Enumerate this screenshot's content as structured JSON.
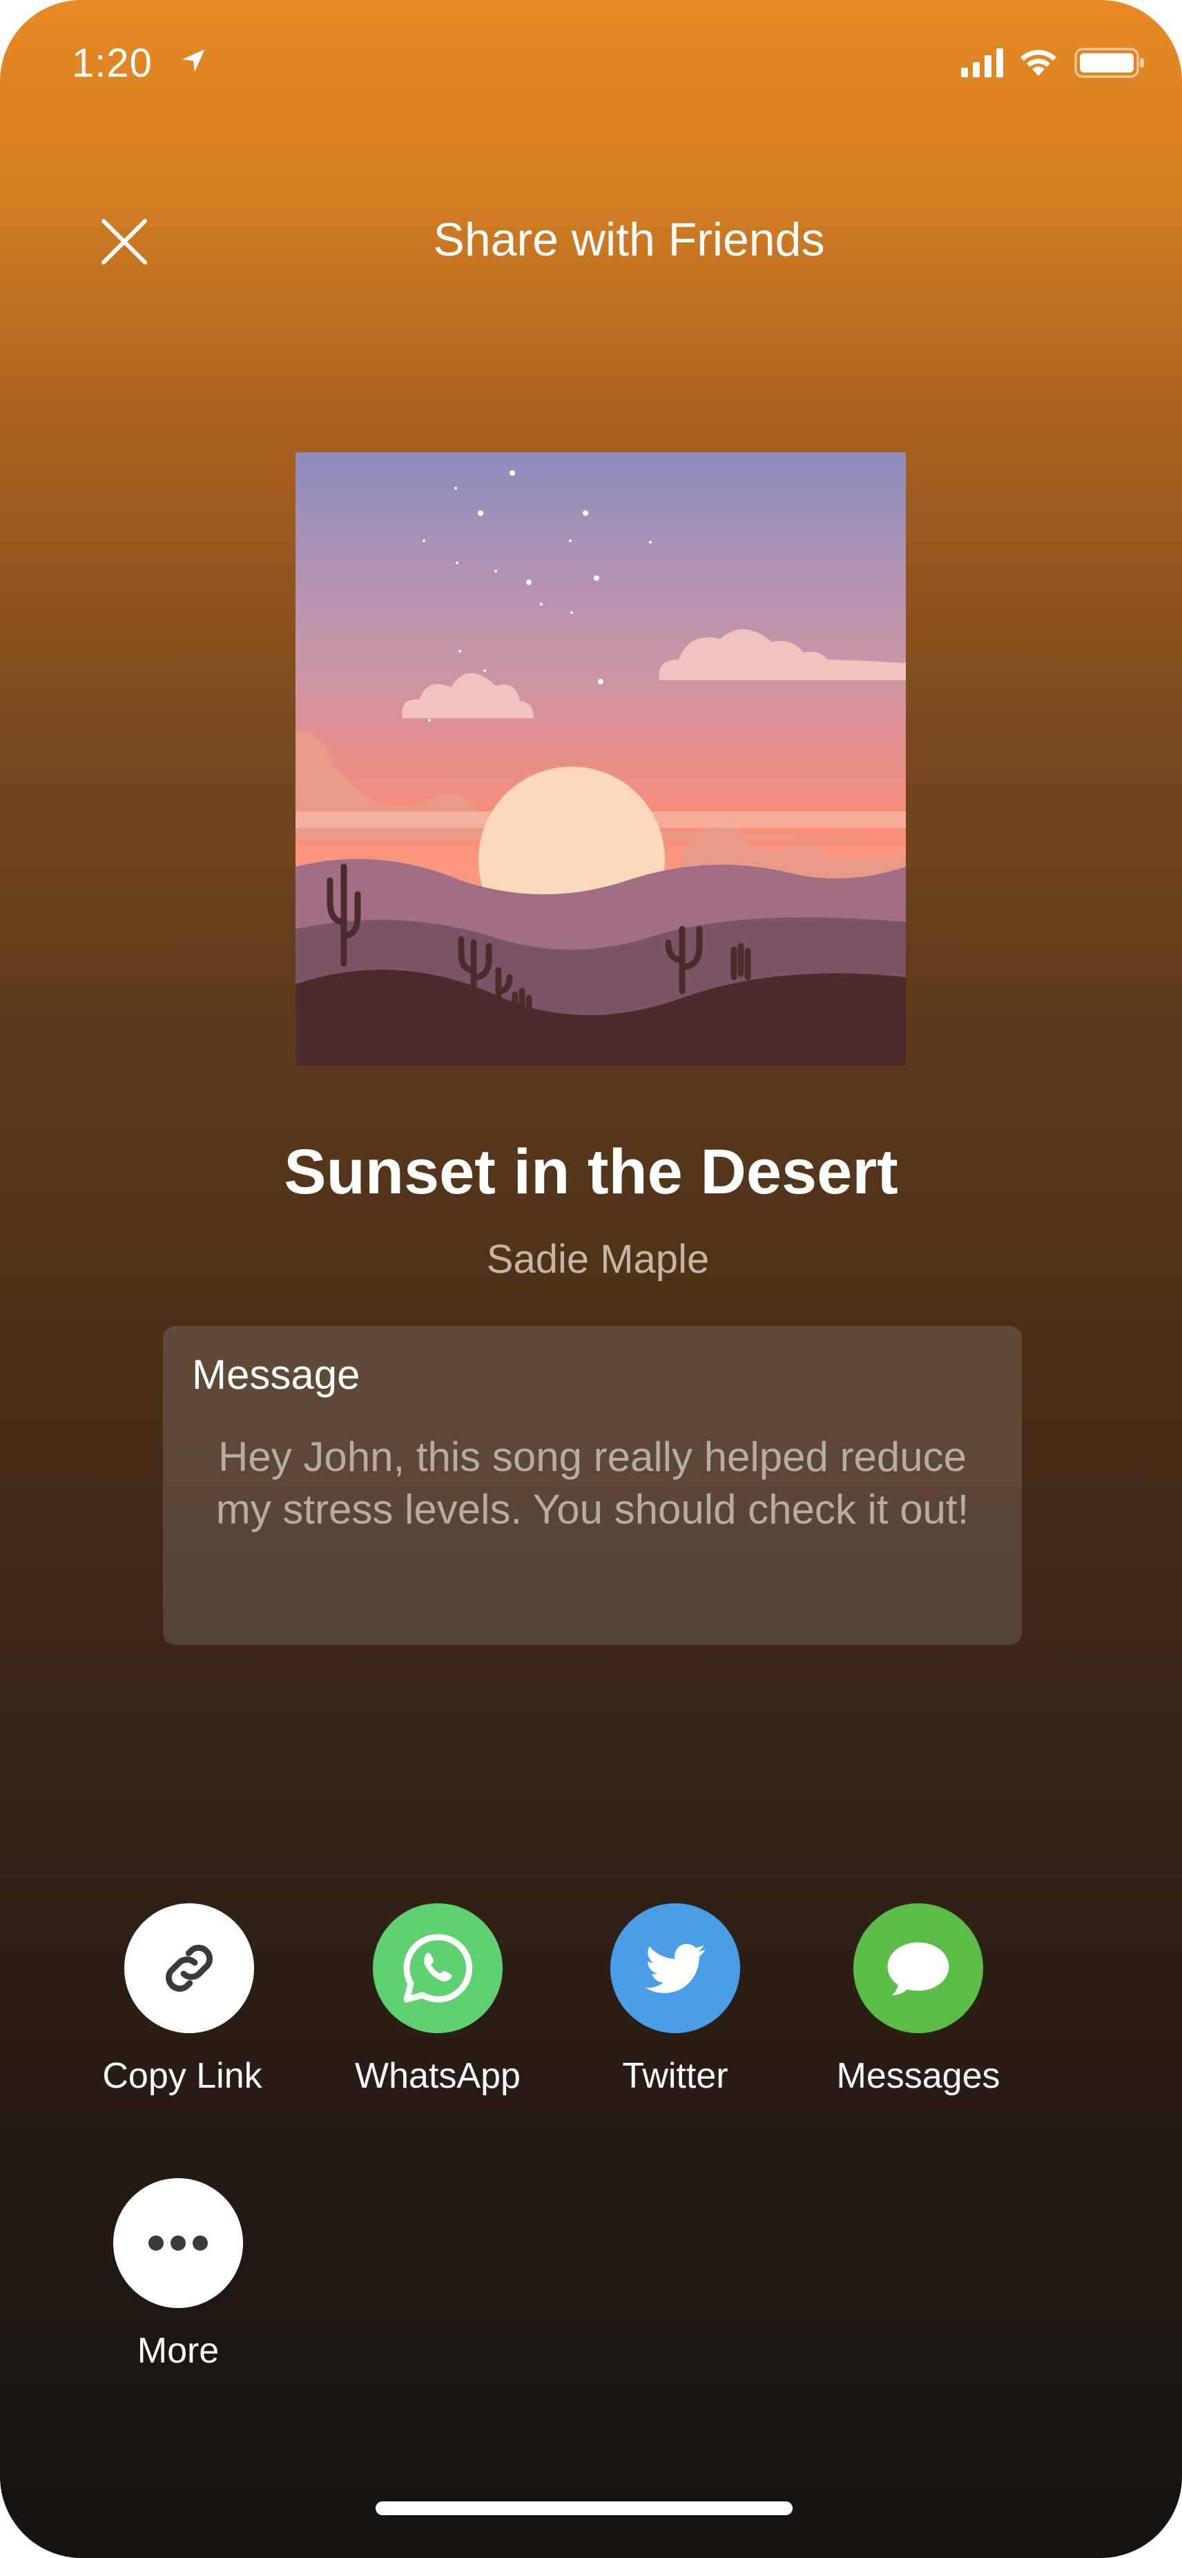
{
  "status_bar": {
    "time": "1:20",
    "icons": [
      "location-arrow-icon",
      "signal-icon",
      "wifi-icon",
      "battery-icon"
    ]
  },
  "header": {
    "title": "Share with Friends",
    "close_icon": "close-icon"
  },
  "song": {
    "title": "Sunset in the Desert",
    "artist": "Sadie Maple"
  },
  "message": {
    "label": "Message",
    "text": "Hey John, this song really helped reduce my stress levels. You should check it out!"
  },
  "share_targets": [
    {
      "label": "Copy Link",
      "icon": "link-icon",
      "color": "#ffffff"
    },
    {
      "label": "WhatsApp",
      "icon": "whatsapp-icon",
      "color": "#5fd070"
    },
    {
      "label": "Twitter",
      "icon": "twitter-bird-icon",
      "color": "#4a9ee8"
    },
    {
      "label": "Messages",
      "icon": "speech-bubble-icon",
      "color": "#5bbd48"
    },
    {
      "label": "More",
      "icon": "ellipsis-icon",
      "color": "#ffffff"
    }
  ],
  "colors": {
    "gradient_top": "#e88a23",
    "gradient_bottom": "#161210",
    "whatsapp": "#5fd070",
    "twitter": "#4a9ee8",
    "messages": "#5bbd48"
  }
}
